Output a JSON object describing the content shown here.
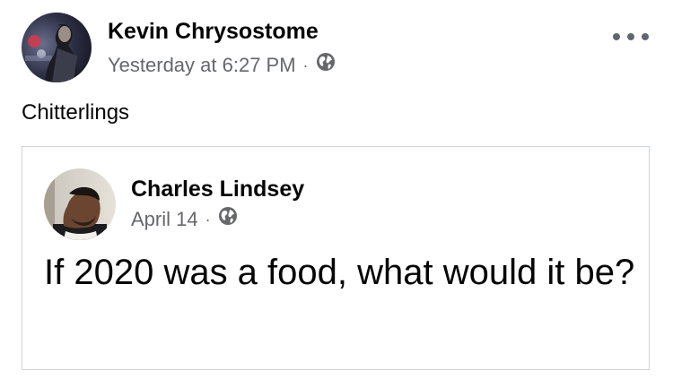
{
  "post": {
    "author": "Kevin Chrysostome",
    "timestamp": "Yesterday at 6:27 PM",
    "separator": "·",
    "privacy_icon": "globe-icon",
    "more_icon": "more-options-icon",
    "text": "Chitterlings"
  },
  "shared_post": {
    "author": "Charles Lindsey",
    "timestamp": "April 14",
    "separator": "·",
    "privacy_icon": "globe-icon",
    "text": "If 2020 was a food, what would it be?"
  },
  "colors": {
    "text": "#050505",
    "secondary_text": "#65676b",
    "border": "#d0d3d8"
  }
}
